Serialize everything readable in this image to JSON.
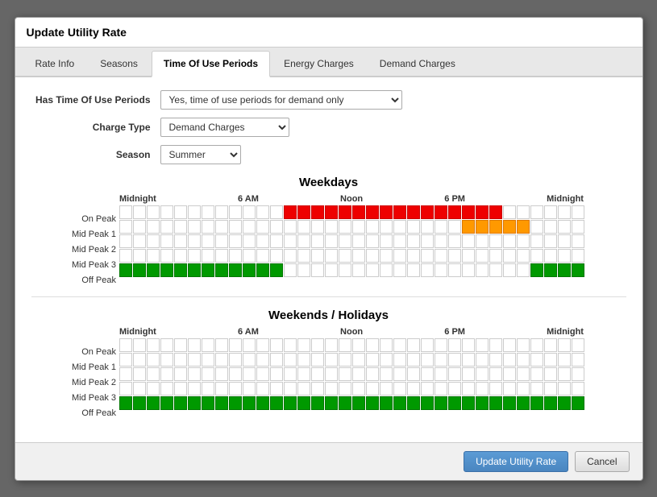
{
  "dialog": {
    "title": "Update Utility Rate",
    "tabs": [
      {
        "id": "rate-info",
        "label": "Rate Info",
        "active": false
      },
      {
        "id": "seasons",
        "label": "Seasons",
        "active": false
      },
      {
        "id": "time-of-use",
        "label": "Time Of Use Periods",
        "active": true
      },
      {
        "id": "energy-charges",
        "label": "Energy Charges",
        "active": false
      },
      {
        "id": "demand-charges",
        "label": "Demand Charges",
        "active": false
      }
    ]
  },
  "form": {
    "hasTimeOfUseLabel": "Has Time Of Use Periods",
    "hasTimeOfUseValue": "Yes, time of use periods for demand only",
    "chargeTypeLabel": "Charge Type",
    "chargeTypeValue": "Demand Charges",
    "seasonLabel": "Season",
    "seasonValue": "Summer"
  },
  "weekdays": {
    "title": "Weekdays",
    "timeLabels": [
      "Midnight",
      "6 AM",
      "Noon",
      "6 PM",
      "Midnight"
    ],
    "rowLabels": [
      "On Peak",
      "Mid Peak 1",
      "Mid Peak 2",
      "Mid Peak 3",
      "Off Peak"
    ]
  },
  "weekendsHolidays": {
    "title": "Weekends / Holidays",
    "timeLabels": [
      "Midnight",
      "6 AM",
      "Noon",
      "6 PM",
      "Midnight"
    ],
    "rowLabels": [
      "On Peak",
      "Mid Peak 1",
      "Mid Peak 2",
      "Mid Peak 3",
      "Off Peak"
    ]
  },
  "footer": {
    "updateButtonLabel": "Update Utility Rate",
    "cancelButtonLabel": "Cancel"
  }
}
